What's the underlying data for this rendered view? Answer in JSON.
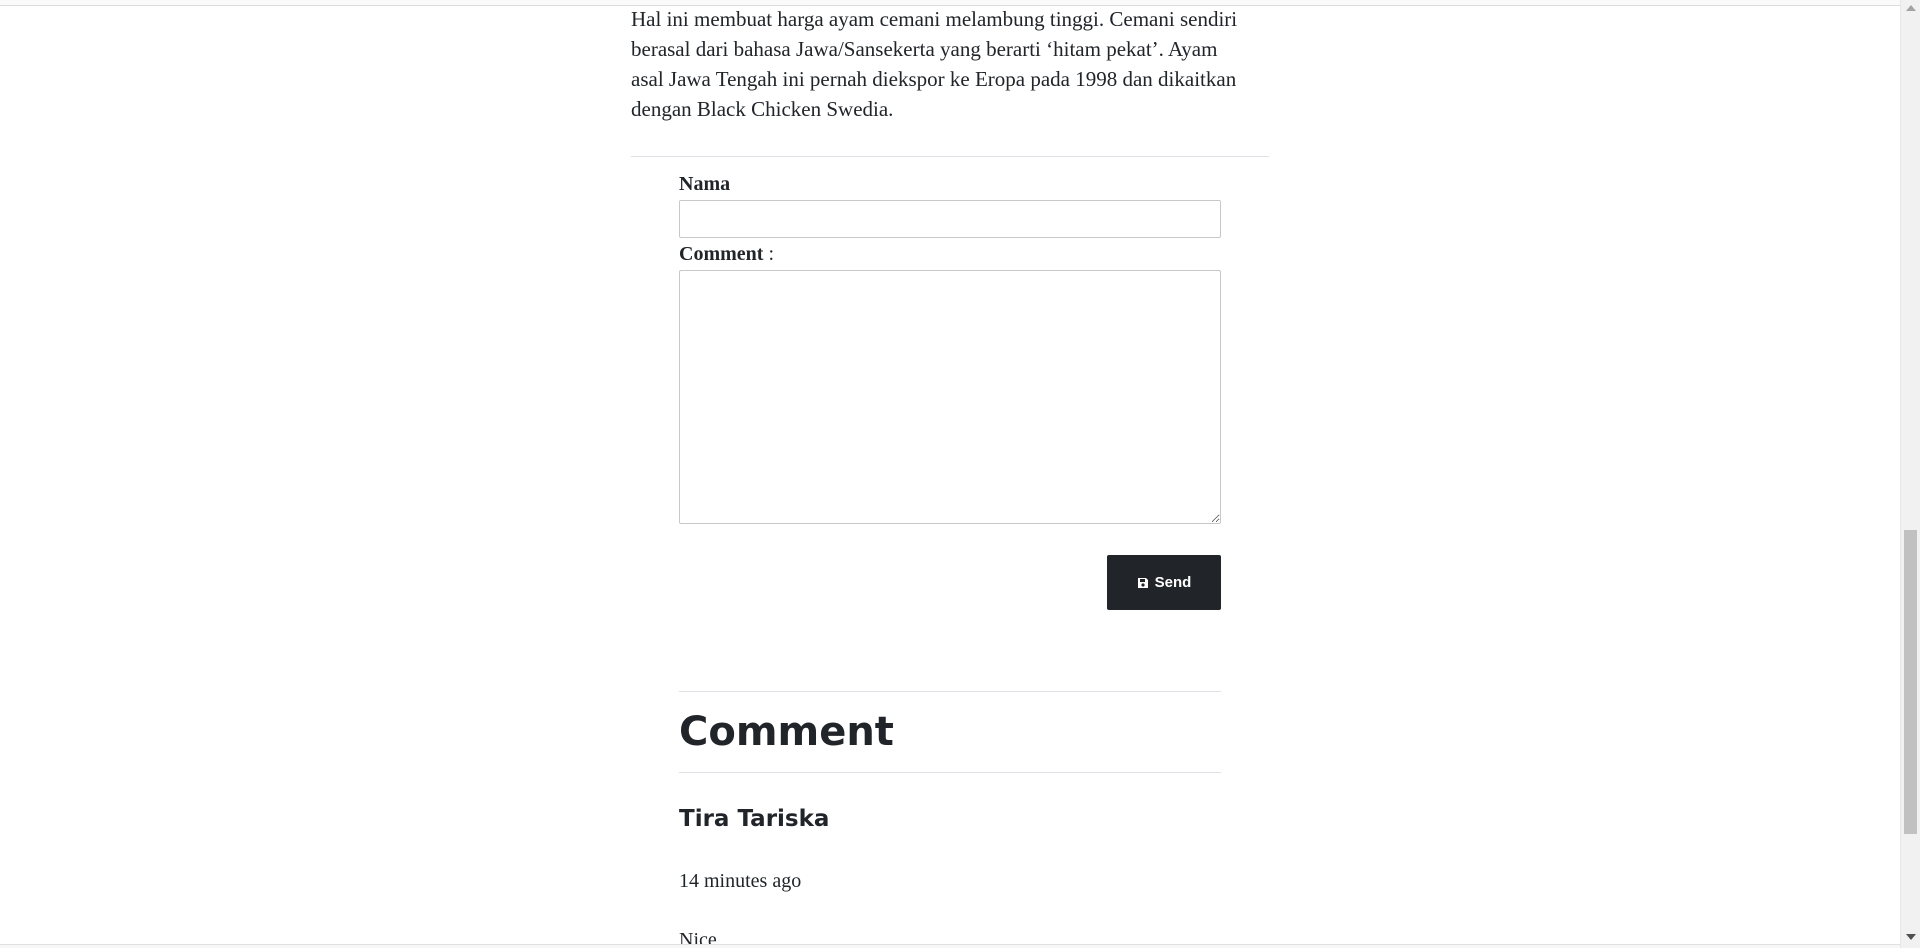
{
  "article": {
    "paragraph": "Hal ini membuat harga ayam cemani melambung tinggi. Cemani sendiri berasal dari bahasa Jawa/Sansekerta yang berarti ‘hitam pekat’. Ayam asal Jawa Tengah ini pernah diekspor ke Eropa pada 1998 dan dikaitkan dengan Black Chicken Swedia."
  },
  "form": {
    "name_label": "Nama",
    "name_value": "",
    "comment_label": "Comment",
    "comment_colon": " :",
    "comment_value": "",
    "send_label": "Send",
    "send_icon": "floppy-disk-icon"
  },
  "comments": {
    "heading": "Comment",
    "items": [
      {
        "author": "Tira Tariska",
        "time": "14 minutes ago",
        "body": "Nice"
      }
    ]
  }
}
